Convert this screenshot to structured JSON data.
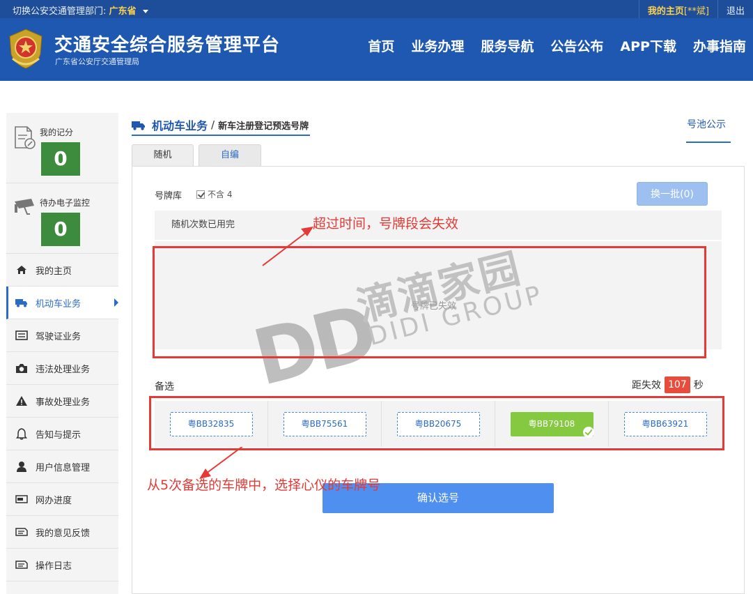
{
  "topbar": {
    "dept_label": "切换公安交通管理部门:",
    "province": "广东省",
    "home_label": "我的主页",
    "user": "[**斌]",
    "logout": "退出"
  },
  "header": {
    "title": "交通安全综合服务管理平台",
    "subtitle": "广东省公安厅交通管理局",
    "nav": [
      "首页",
      "业务办理",
      "服务导航",
      "公告公布",
      "APP下载",
      "办事指南"
    ]
  },
  "sidebar": {
    "score_label": "我的记分",
    "score_value": "0",
    "monitor_label": "待办电子监控",
    "monitor_value": "0",
    "items": [
      {
        "label": "我的主页",
        "icon": "home-icon"
      },
      {
        "label": "机动车业务",
        "icon": "truck-icon"
      },
      {
        "label": "驾驶证业务",
        "icon": "license-icon"
      },
      {
        "label": "违法处理业务",
        "icon": "camera-icon"
      },
      {
        "label": "事故处理业务",
        "icon": "warning-icon"
      },
      {
        "label": "告知与提示",
        "icon": "bell-icon"
      },
      {
        "label": "用户信息管理",
        "icon": "user-icon"
      },
      {
        "label": "网办进度",
        "icon": "progress-icon"
      },
      {
        "label": "我的意见反馈",
        "icon": "feedback-icon"
      },
      {
        "label": "操作日志",
        "icon": "log-icon"
      }
    ]
  },
  "breadcrumb": {
    "section": "机动车业务",
    "separator": "/",
    "page": "新车注册登记预选号牌"
  },
  "pool_link": "号池公示",
  "tabs": [
    "随机",
    "自编"
  ],
  "library": {
    "label": "号牌库",
    "checkbox_label": "不含 4",
    "swap_button": "换一批(0)",
    "notice": "随机次数已用完",
    "status": "号牌已失效"
  },
  "annotations": {
    "top": "超过时间，号牌段会失效",
    "bottom": "从5次备选的车牌中，选择心仪的车牌号"
  },
  "backup": {
    "label": "备选",
    "expire_prefix": "距失效",
    "seconds": "107",
    "expire_suffix": "秒",
    "plates": [
      "粤BB32835",
      "粤BB75561",
      "粤BB20675",
      "粤BB79108",
      "粤BB63921"
    ],
    "selected_index": 3
  },
  "confirm_button": "确认选号",
  "watermark": {
    "logo": "DD",
    "cn": "滴滴家园",
    "en": "DIDI GROUP"
  },
  "colors": {
    "header_blue": "#1f58b0",
    "selected_green": "#84c93f",
    "annotation_red": "#e53935"
  }
}
